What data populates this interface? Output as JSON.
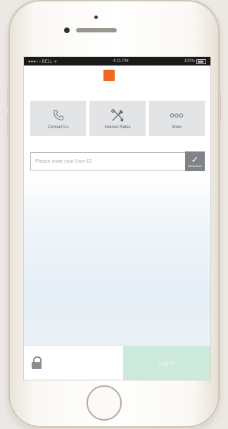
{
  "status_bar": {
    "carrier": "●●●○○ BELL ᯤ",
    "time": "4:21 PM",
    "battery": "100%"
  },
  "tiles": [
    {
      "label": "Contact Us",
      "icon": "phone-icon"
    },
    {
      "label": "Interest Rates",
      "icon": "tools-icon"
    },
    {
      "label": "More",
      "icon": "more-icon"
    }
  ],
  "login": {
    "userid_placeholder": "Please enter your User ID",
    "remember_label": "Remember",
    "login_button": "Log In"
  },
  "colors": {
    "logo": "#f26522",
    "login_button": "#cde9db",
    "tile_bg": "#e3e4e6"
  }
}
